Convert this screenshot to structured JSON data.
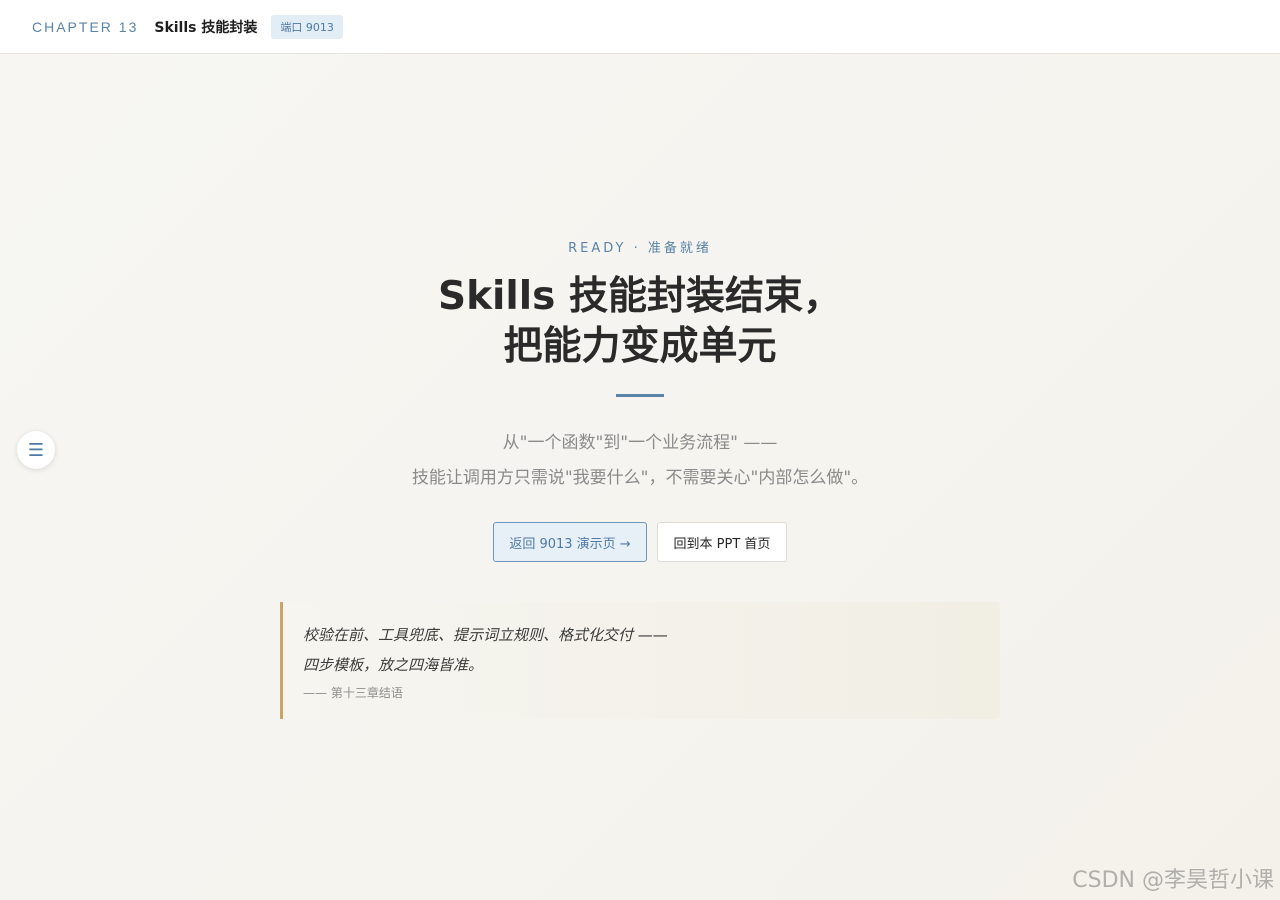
{
  "header": {
    "chapter": "CHAPTER 13",
    "title": "Skills 技能封装",
    "port_badge": "端口 9013"
  },
  "nav": {
    "menu_icon": "hamburger-menu-icon",
    "menu_glyph": "☰"
  },
  "main": {
    "eyebrow": "READY · 准备就绪",
    "headline_line1": "Skills 技能封装结束，",
    "headline_line2": "把能力变成单元",
    "subtitle_line1": "从\"一个函数\"到\"一个业务流程\" ——",
    "subtitle_line2": "技能让调用方只需说\"我要什么\"，不需要关心\"内部怎么做\"。",
    "buttons": {
      "primary": "返回 9013 演示页 →",
      "secondary": "回到本 PPT 首页"
    },
    "quote": {
      "line1": "校验在前、工具兜底、提示词立规则、格式化交付 ——",
      "line2": "四步模板，放之四海皆准。",
      "source": "—— 第十三章结语"
    }
  },
  "watermark": "CSDN @李昊哲小课",
  "colors": {
    "accent": "#5a84a8",
    "quote_border": "#c9a462",
    "background": "#f6f5f1"
  }
}
